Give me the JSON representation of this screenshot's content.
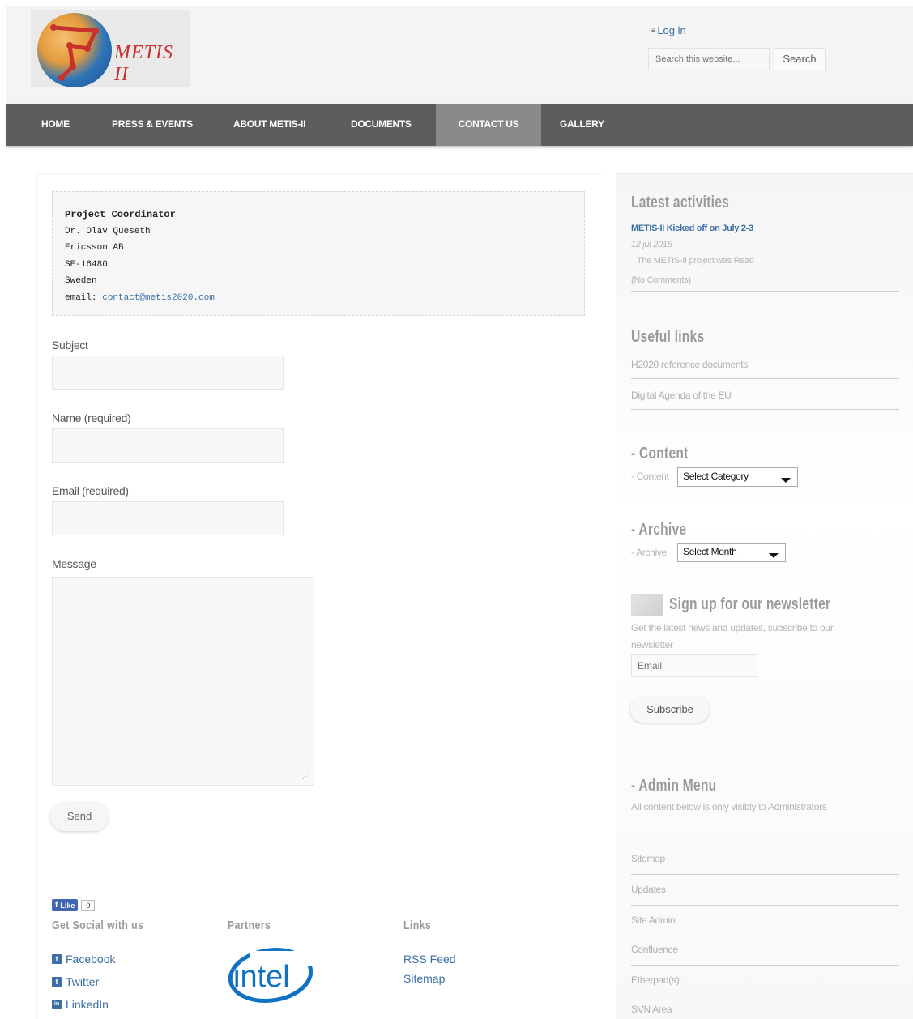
{
  "header": {
    "logo_text": "METIS II",
    "login_label": "Log in",
    "search_placeholder": "Search this website...",
    "search_button": "Search"
  },
  "nav": {
    "items": [
      {
        "label": "HOME"
      },
      {
        "label": "PRESS & EVENTS"
      },
      {
        "label": "ABOUT METIS-II"
      },
      {
        "label": "DOCUMENTS"
      },
      {
        "label": "CONTACT US"
      },
      {
        "label": "GALLERY"
      }
    ],
    "active": "CONTACT US"
  },
  "contact": {
    "title": "Project Coordinator",
    "name": "Dr. Olav Queseth",
    "company": "Ericsson AB",
    "postal": "SE-16480",
    "country": "Sweden",
    "email_label": "email:",
    "email": "contact@metis2020.com"
  },
  "form": {
    "subject_label": "Subject",
    "name_label": "Name (required)",
    "email_label": "Email (required)",
    "message_label": "Message",
    "send_button": "Send"
  },
  "footer": {
    "like_label": "Like",
    "like_count": "0",
    "social_heading": "Get Social with us",
    "social": [
      {
        "icon": "facebook-icon",
        "glyph": "f",
        "label": "Facebook"
      },
      {
        "icon": "twitter-icon",
        "glyph": "t",
        "label": "Twitter"
      },
      {
        "icon": "linkedin-icon",
        "glyph": "in",
        "label": "LinkedIn"
      }
    ],
    "partners_heading": "Partners",
    "partner_logo": "intel",
    "links_heading": "Links",
    "links": [
      {
        "label": "RSS Feed"
      },
      {
        "label": "Sitemap"
      }
    ]
  },
  "sidebar": {
    "latest_heading": "Latest activities",
    "activity_title": "METIS-II Kicked off on July 2-3",
    "activity_date": "12 jul 2015",
    "activity_excerpt": "The METIS-II project was Read →",
    "activity_comments": "(No Comments)",
    "useful_heading": "Useful links",
    "useful_links": [
      {
        "label": "H2020 reference documents"
      },
      {
        "label": "Digital Agenda of the EU"
      }
    ],
    "content_heading": "- Content",
    "content_label": "- Content",
    "content_select": "Select Category",
    "archive_heading": "- Archive",
    "archive_label": "- Archive",
    "archive_select": "Select Month",
    "newsletter_heading": "Sign up for our newsletter",
    "newsletter_text": "Get the latest news and updates, subscribe to our newsletter",
    "newsletter_placeholder": "Email",
    "subscribe_button": "Subscribe",
    "admin_heading": "- Admin Menu",
    "admin_text": "All content below is only visibly to Administrators",
    "admin_links": [
      {
        "label": "Sitemap"
      },
      {
        "label": "Updates"
      },
      {
        "label": "Site Admin"
      },
      {
        "label": "Confluence"
      },
      {
        "label": "Etherpad(s)"
      },
      {
        "label": "SVN Area"
      }
    ]
  },
  "colors": {
    "nav_bg": "#5d5d5d",
    "nav_active": "#8a8a8a",
    "link": "#3a6ea5",
    "logo_red": "#c8322c"
  }
}
